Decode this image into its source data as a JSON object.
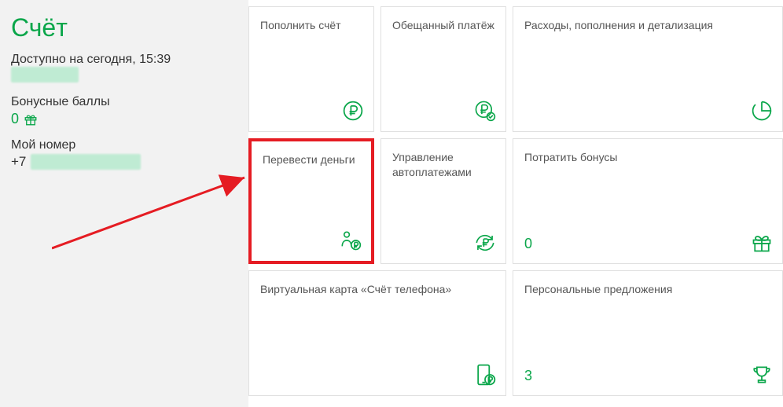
{
  "sidebar": {
    "title": "Счёт",
    "available_label": "Доступно на сегодня, 15:39",
    "bonus_label": "Бонусные баллы",
    "bonus_value": "0",
    "my_number_label": "Мой номер",
    "my_number_prefix": "+7"
  },
  "cards": {
    "0": {
      "title": "Пополнить счёт"
    },
    "1": {
      "title": "Обещанный платёж"
    },
    "2": {
      "title": "Расходы, пополнения и детализация"
    },
    "3": {
      "title": "Перевести деньги"
    },
    "4": {
      "title": "Управление автоплатежами"
    },
    "5": {
      "title": "Потратить бонусы",
      "value": "0"
    },
    "6": {
      "title": "Виртуальная карта «Счёт телефона»"
    },
    "7": {
      "title": "Персональные предложения",
      "value": "3"
    }
  },
  "colors": {
    "accent": "#0aa64a",
    "highlight": "#e51c23"
  }
}
